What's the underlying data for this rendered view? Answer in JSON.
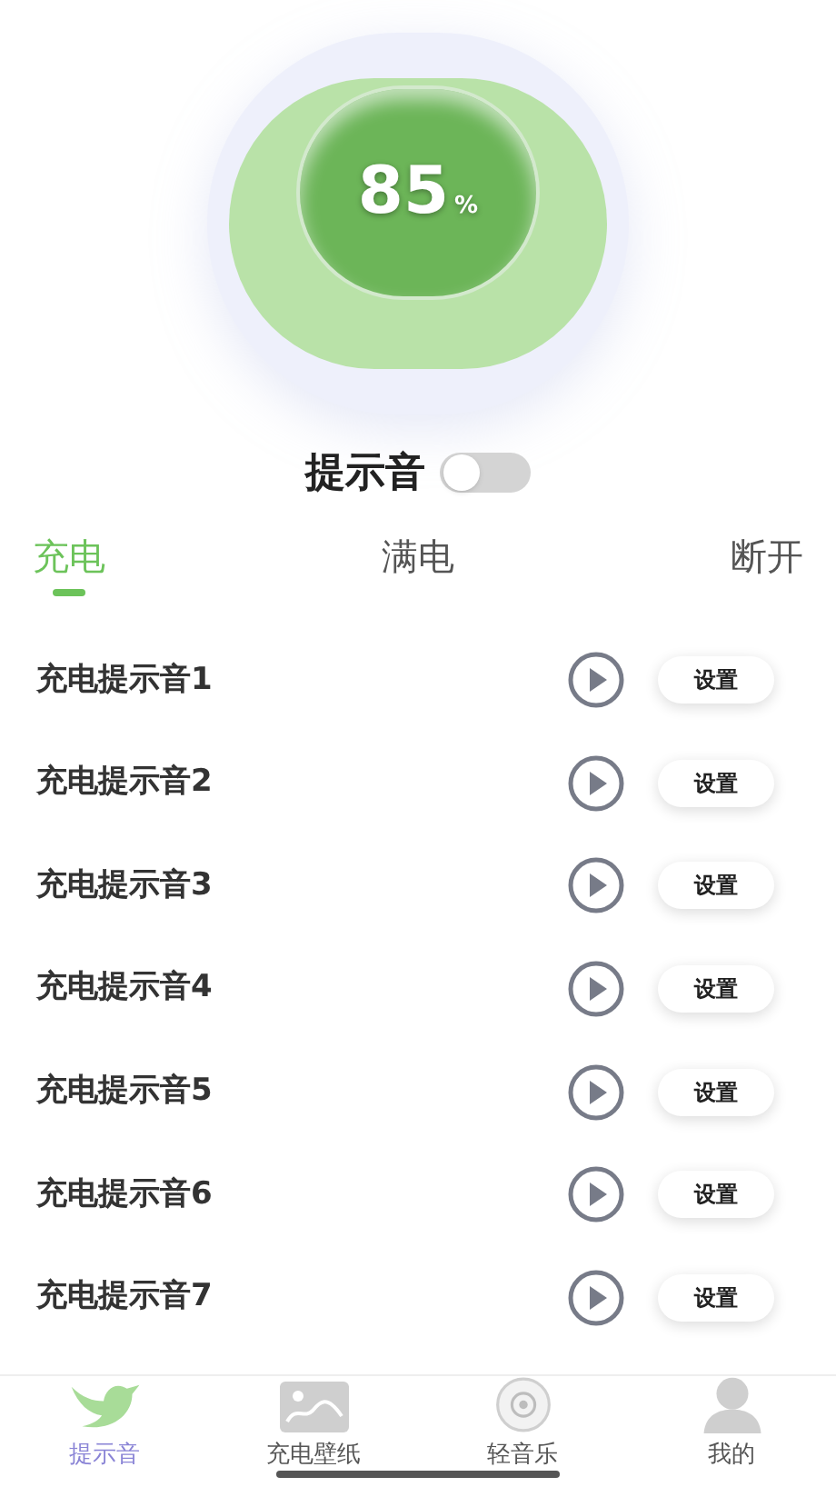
{
  "battery": {
    "value": "85",
    "unit": "%"
  },
  "sound_toggle": {
    "label": "提示音",
    "on": false
  },
  "tabs": [
    {
      "label": "充电",
      "selected": true
    },
    {
      "label": "满电",
      "selected": false
    },
    {
      "label": "断开",
      "selected": false
    }
  ],
  "sounds": [
    {
      "name": "充电提示音1",
      "button": "设置"
    },
    {
      "name": "充电提示音2",
      "button": "设置"
    },
    {
      "name": "充电提示音3",
      "button": "设置"
    },
    {
      "name": "充电提示音4",
      "button": "设置"
    },
    {
      "name": "充电提示音5",
      "button": "设置"
    },
    {
      "name": "充电提示音6",
      "button": "设置"
    },
    {
      "name": "充电提示音7",
      "button": "设置"
    }
  ],
  "nav": [
    {
      "label": "提示音",
      "selected": true
    },
    {
      "label": "充电壁纸",
      "selected": false
    },
    {
      "label": "轻音乐",
      "selected": false
    },
    {
      "label": "我的",
      "selected": false
    }
  ]
}
